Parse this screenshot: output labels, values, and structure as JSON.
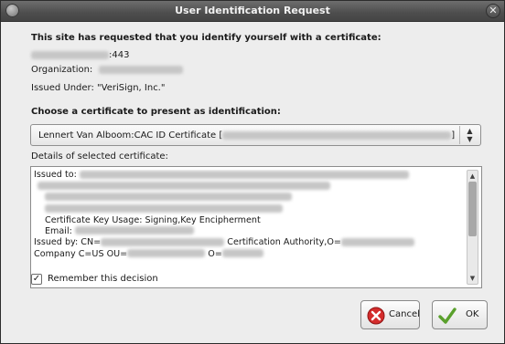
{
  "window": {
    "title": "User Identification Request"
  },
  "intro": {
    "heading": "This site has requested that you identify yourself with a certificate:",
    "port": ":443",
    "organization_label": "Organization:",
    "issued_under": "Issued Under: \"VeriSign, Inc.\""
  },
  "chooser": {
    "heading": "Choose a certificate to present as identification:",
    "selected": "Lennert Van Alboom:CAC ID Certificate [",
    "selected_end": "]"
  },
  "details": {
    "label": "Details of selected certificate:",
    "issued_to": "Issued to:",
    "key_usage": "Certificate Key Usage: Signing,Key Encipherment",
    "email": "Email:",
    "issued_by_prefix": "Issued by: CN=",
    "issued_by_middle": "Certification Authority,O=",
    "company_prefix": "Company C=US OU=",
    "company_middle": "O="
  },
  "remember": {
    "label": "Remember this decision",
    "checked": true
  },
  "buttons": {
    "cancel": "Cancel",
    "ok": "OK"
  },
  "colors": {
    "titlebar": "#4d4d4d",
    "dialog_bg": "#ededed",
    "cancel_icon": "#d42c2c",
    "ok_icon": "#5aa02c"
  }
}
